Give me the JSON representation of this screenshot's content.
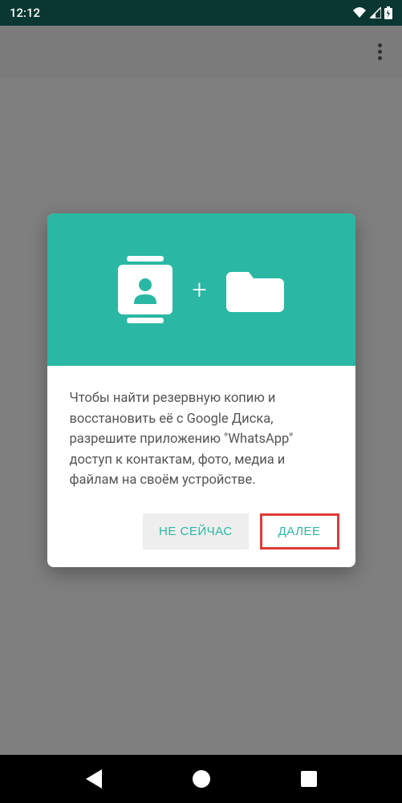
{
  "status": {
    "time": "12:12"
  },
  "dialog": {
    "body_text": "Чтобы найти резервную копию и восстановить её с Google Диска, разрешите приложению \"WhatsApp\" доступ к контактам, фото, медиа и файлам на своём устройстве.",
    "not_now_label": "НЕ СЕЙЧАС",
    "next_label": "ДАЛЕЕ"
  },
  "colors": {
    "accent": "#2ab8a4",
    "highlight_border": "#e03a3a"
  }
}
